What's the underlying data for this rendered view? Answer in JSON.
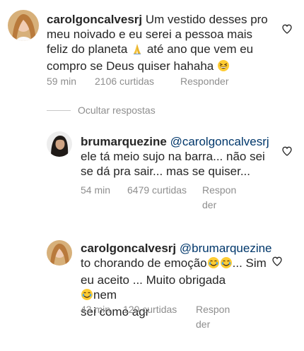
{
  "comments": [
    {
      "username": "carolgoncalvesrj",
      "text_part1": "Um vestido desses pro meu noivado e eu serei a pessoa mais feliz do planeta",
      "text_part2": "até ano que vem eu compro se Deus quiser hahaha",
      "emoji_1": "praying-hands-icon",
      "emoji_2": "grinning-squint-face-icon",
      "time": "59 min",
      "likes": "2106 curtidas",
      "reply_label": "Responder"
    }
  ],
  "hide_replies_label": "Ocultar respostas",
  "replies": [
    {
      "username": "brumarquezine",
      "mention": "@carolgoncalvesrj",
      "text_line1": "ele tá meio sujo na barra... não sei",
      "text_line2": "se dá pra sair... mas se quiser...",
      "time": "54 min",
      "likes": "6479 curtidas",
      "reply_label_line1": "Respon",
      "reply_label_line2": "der"
    },
    {
      "username": "carolgoncalvesrj",
      "mention": "@brumarquezine",
      "text_line1": "to chorando de emoção",
      "text_line2_a": "Sim",
      "text_line2_b": "eu aceito ... Muito obrigada",
      "text_line3_a": "nem",
      "text_line3_b": "sei como agr",
      "time": "43 min",
      "likes": "120 curtidas",
      "reply_label_line1": "Respon",
      "reply_label_line2": "der"
    }
  ],
  "colors": {
    "text": "#262626",
    "meta": "#8e8e8e",
    "mention": "#00376b",
    "heart": "#262626"
  }
}
